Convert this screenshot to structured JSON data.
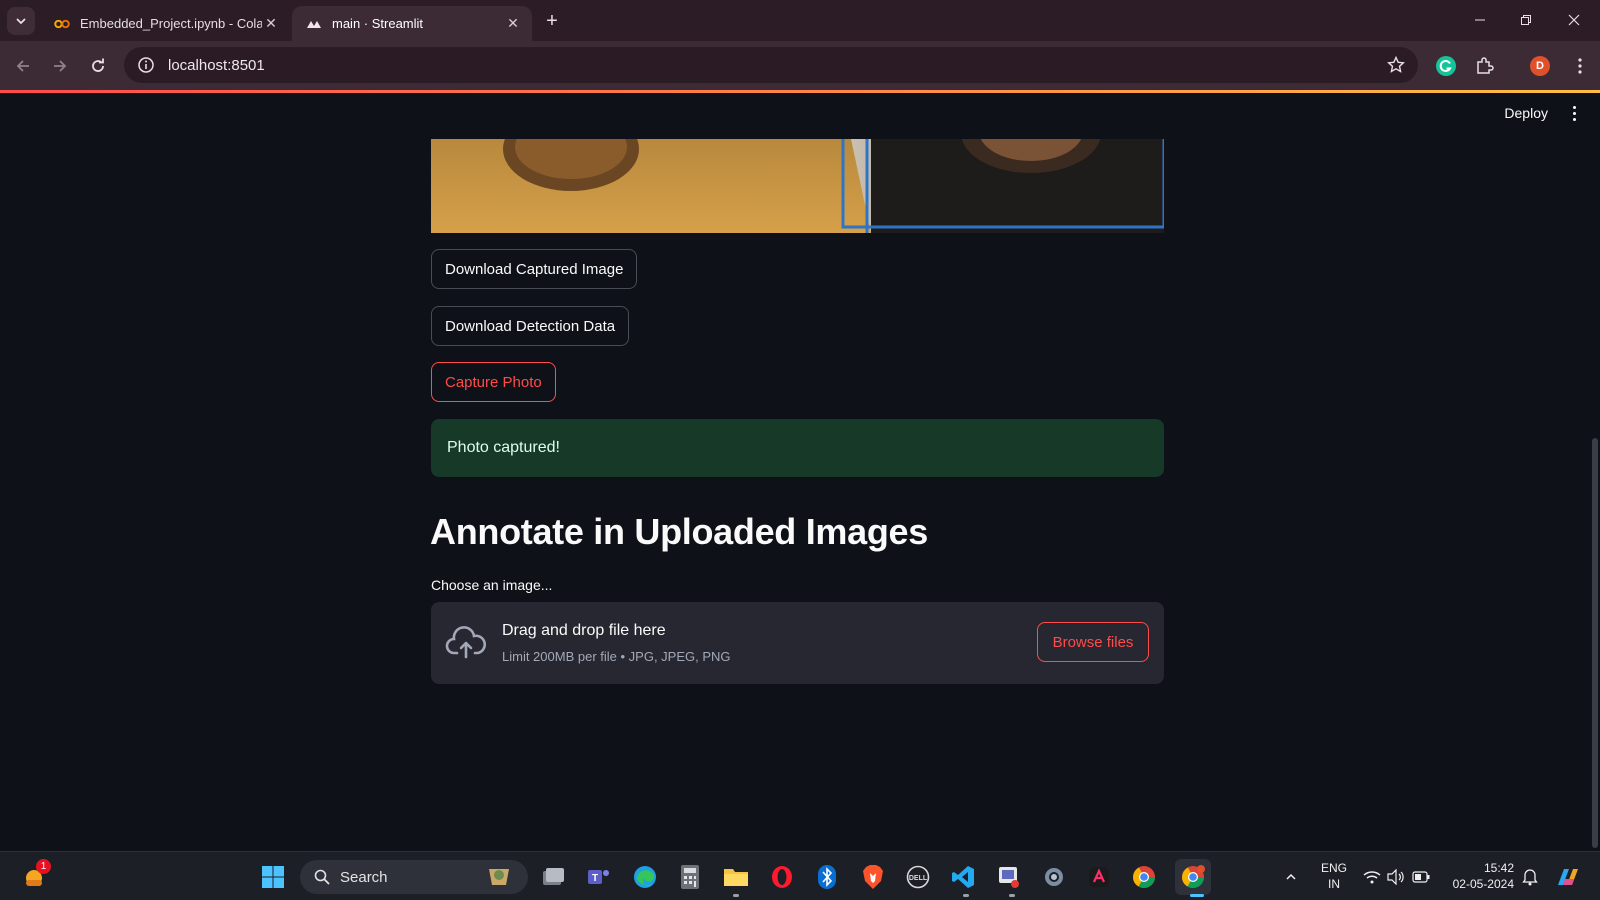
{
  "browser": {
    "tabs": [
      {
        "title": "Embedded_Project.ipynb - Colab",
        "favicon": "colab-icon",
        "active": false
      },
      {
        "title": "main · Streamlit",
        "favicon": "streamlit-icon",
        "active": true
      }
    ],
    "url": "localhost:8501",
    "profile_initial": "D"
  },
  "app": {
    "header": {
      "deploy_label": "Deploy"
    },
    "buttons": {
      "download_image": "Download Captured Image",
      "download_data": "Download Detection Data",
      "capture_photo": "Capture Photo"
    },
    "success_message": "Photo captured!",
    "section_title": "Annotate in Uploaded Images",
    "uploader": {
      "label": "Choose an image...",
      "drop_text": "Drag and drop file here",
      "limit_text": "Limit 200MB per file • JPG, JPEG, PNG",
      "browse_label": "Browse files"
    }
  },
  "taskbar": {
    "search_label": "Search",
    "notification_badge": "1",
    "language": "ENG",
    "region": "IN",
    "time": "15:42",
    "date": "02-05-2024"
  },
  "colors": {
    "accent": "#ff4b4b",
    "app_bg": "#0e1117",
    "success_bg": "#173928",
    "browser_frame": "#3c2a35"
  }
}
